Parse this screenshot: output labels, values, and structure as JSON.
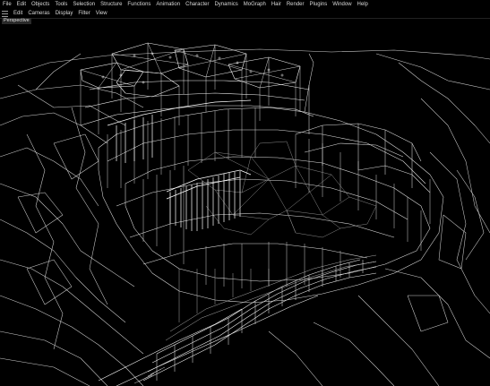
{
  "menu": [
    "File",
    "Edit",
    "Objects",
    "Tools",
    "Selection",
    "Structure",
    "Functions",
    "Animation",
    "Character",
    "Dynamics",
    "MoGraph",
    "Hair",
    "Render",
    "Plugins",
    "Window",
    "Help"
  ],
  "view_menu": [
    "Edit",
    "Cameras",
    "Display",
    "Filter",
    "View"
  ],
  "viewport": {
    "label": "Perspective",
    "background": "#000000",
    "wire_color": "#e8e8e8"
  },
  "icons": {
    "panel_grip": "hamburger-grip-icon"
  }
}
